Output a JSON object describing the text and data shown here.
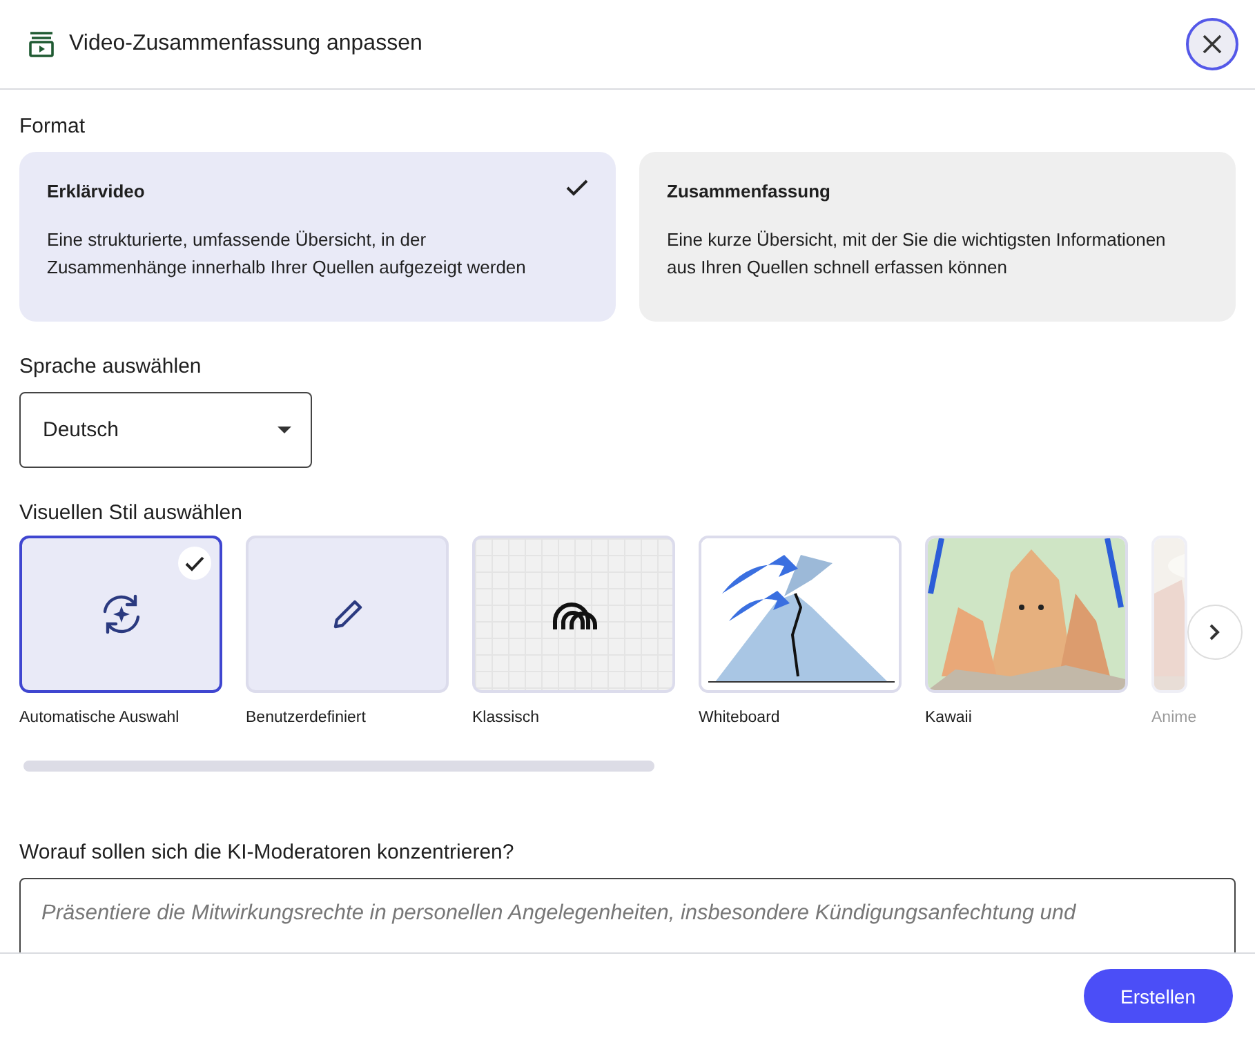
{
  "dialog": {
    "title": "Video-Zusammenfassung anpassen"
  },
  "format": {
    "label": "Format",
    "options": [
      {
        "title": "Erklärvideo",
        "description": "Eine strukturierte, umfassende Übersicht, in der Zusammenhänge innerhalb Ihrer Quellen aufgezeigt werden",
        "selected": true
      },
      {
        "title": "Zusammenfassung",
        "description": "Eine kurze Übersicht, mit der Sie die wichtigsten Informationen aus Ihren Quellen schnell erfassen können",
        "selected": false
      }
    ]
  },
  "language": {
    "label": "Sprache auswählen",
    "value": "Deutsch"
  },
  "style": {
    "label": "Visuellen Stil auswählen",
    "options": [
      {
        "kind": "auto",
        "label": "Automatische Auswahl",
        "selected": true
      },
      {
        "kind": "custom",
        "label": "Benutzerdefiniert",
        "selected": false
      },
      {
        "kind": "classic",
        "label": "Klassisch",
        "selected": false
      },
      {
        "kind": "whiteboard",
        "label": "Whiteboard",
        "selected": false
      },
      {
        "kind": "kawaii",
        "label": "Kawaii",
        "selected": false
      },
      {
        "kind": "anime",
        "label": "Anime",
        "selected": false
      }
    ]
  },
  "focus": {
    "label": "Worauf sollen sich die KI-Moderatoren konzentrieren?",
    "placeholder": "Präsentiere die Mitwirkungsrechte in personellen Angelegenheiten, insbesondere Kündigungsanfechtung und"
  },
  "buttons": [
    "Erstellen"
  ]
}
